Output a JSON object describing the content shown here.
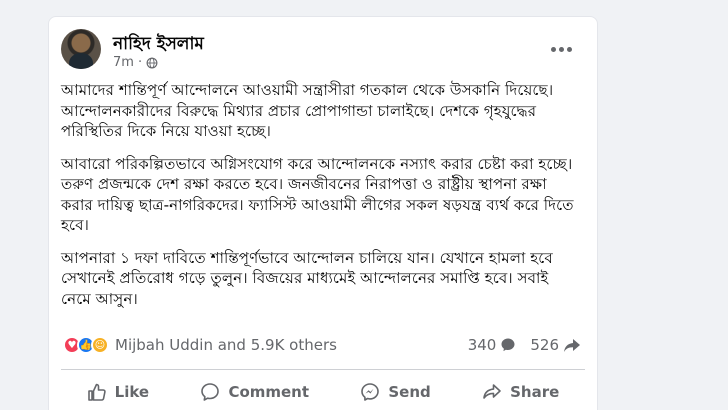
{
  "post": {
    "author": "নাহিদ ইসলাম",
    "time": "7m",
    "separator": "·",
    "paragraphs": [
      "আমাদের শান্তিপূর্ণ আন্দোলনে আওয়ামী সন্ত্রাসীরা গতকাল থেকে উসকানি দিয়েছে। আন্দোলনকারীদের বিরুদ্ধে মিথ্যার প্রচার প্রোপাগান্ডা চালাইছে। দেশকে গৃহযুদ্ধের পরিস্থিতির দিকে নিয়ে যাওয়া হচ্ছে।",
      "আবারো পরিকল্পিতভাবে অগ্নিসংযোগ করে আন্দোলনকে নস্যাৎ করার চেষ্টা করা হচ্ছে। তরুণ প্রজন্মকে দেশ রক্ষা করতে হবে। জনজীবনের নিরাপত্তা ও রাষ্ট্রীয় স্থাপনা রক্ষা করার দায়িত্ব ছাত্র-নাগরিকদের। ফ্যাসিস্ট আওয়ামী লীগের সকল ষড়যন্ত্র ব্যর্থ করে দিতে হবে।",
      "আপনারা ১ দফা দাবিতে শান্তিপূর্ণভাবে আন্দোলন চালিয়ে যান। যেখানে হামলা হবে সেখানেই প্রতিরোধ গড়ে তুলুন। বিজয়ের মাধ্যমেই আন্দোলনের সমাপ্তি হবে। সবাই নেমে আসুন।"
    ]
  },
  "reactions": {
    "summary": "Mijbah Uddin and 5.9K others",
    "comments": "340",
    "shares": "526",
    "icons": [
      "love",
      "like",
      "care"
    ]
  },
  "actions": {
    "like": "Like",
    "comment": "Comment",
    "send": "Send",
    "share": "Share"
  },
  "colors": {
    "primary_text": "#050505",
    "secondary_text": "#65676b",
    "like_blue": "#1877f2",
    "love_red": "#f33e58",
    "care_yellow": "#f7b125"
  }
}
